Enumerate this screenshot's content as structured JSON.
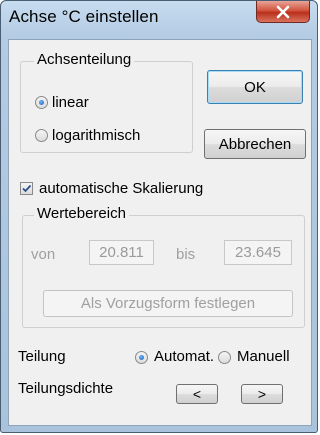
{
  "window": {
    "title": "Achse °C einstellen",
    "close_label": "×"
  },
  "axis_division": {
    "legend": "Achsenteilung",
    "options": [
      {
        "label": "linear",
        "selected": true
      },
      {
        "label": "logarithmisch",
        "selected": false
      }
    ]
  },
  "buttons": {
    "ok": "OK",
    "cancel": "Abbrechen"
  },
  "auto_scale": {
    "label": "automatische Skalierung",
    "checked": true
  },
  "value_range": {
    "legend": "Wertebereich",
    "from_label": "von",
    "from_value": "20.811",
    "to_label": "bis",
    "to_value": "23.645",
    "preferred_button": "Als Vorzugsform festlegen"
  },
  "division": {
    "label": "Teilung",
    "options": [
      {
        "label": "Automat.",
        "selected": true
      },
      {
        "label": "Manuell",
        "selected": false
      }
    ]
  },
  "division_density": {
    "label": "Teilungsdichte",
    "decrease": "<",
    "increase": ">"
  }
}
